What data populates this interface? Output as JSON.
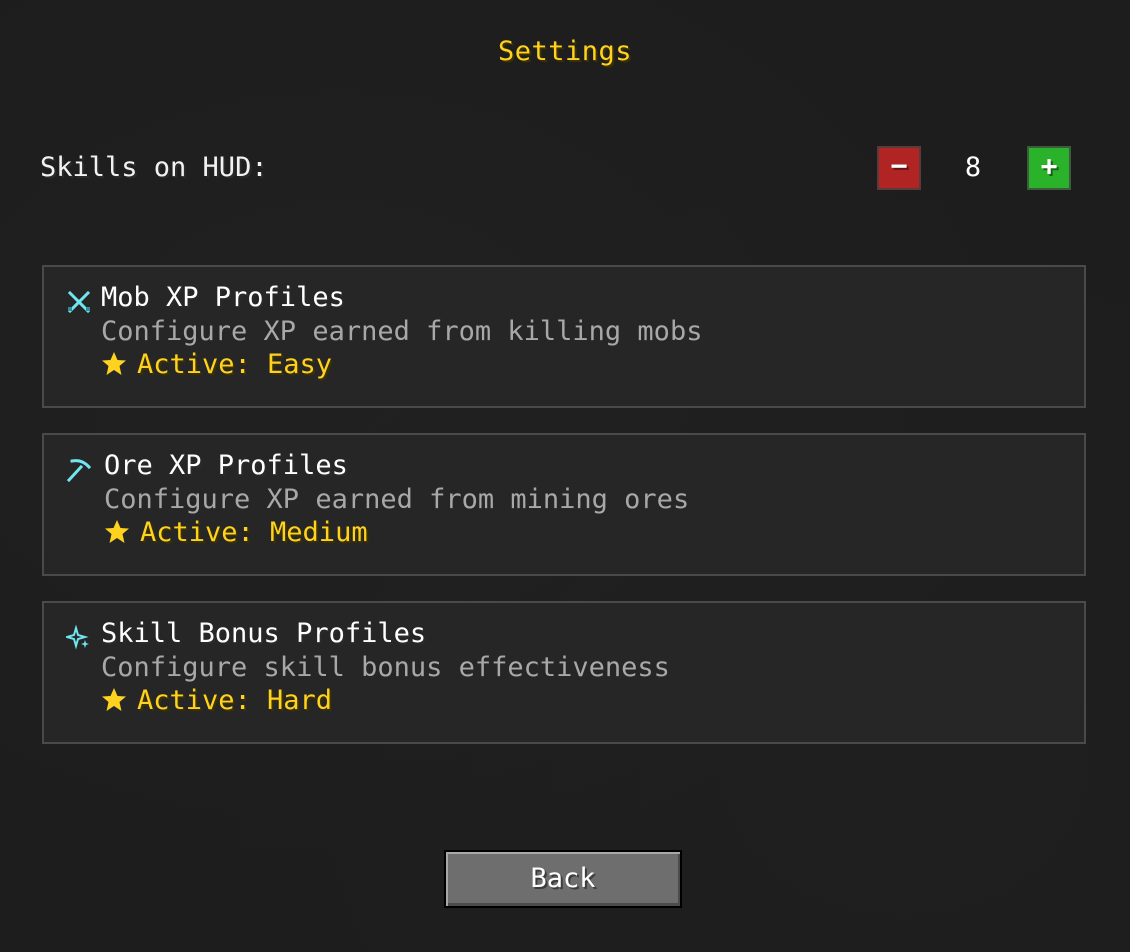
{
  "screen": {
    "title": "Settings"
  },
  "hud": {
    "label": "Skills on HUD:",
    "decrement_label": "−",
    "increment_label": "+",
    "value": "8",
    "decrement_color": "#b02424",
    "increment_color": "#2ab32a"
  },
  "profiles": [
    {
      "icon": "crossed-swords-icon",
      "name": "Mob XP Profiles",
      "description": "Configure XP earned from killing mobs",
      "active": "Active: Easy"
    },
    {
      "icon": "pickaxe-icon",
      "name": "Ore XP Profiles",
      "description": "Configure XP earned from mining ores",
      "active": "Active: Medium"
    },
    {
      "icon": "sparkle-icon",
      "name": "Skill Bonus Profiles",
      "description": "Configure skill bonus effectiveness",
      "active": "Active: Hard"
    }
  ],
  "colors": {
    "accent_yellow": "#ffd21f",
    "icon_cyan": "#6fe6f0",
    "description_gray": "#a8a8a8"
  },
  "footer": {
    "back_label": "Back"
  }
}
